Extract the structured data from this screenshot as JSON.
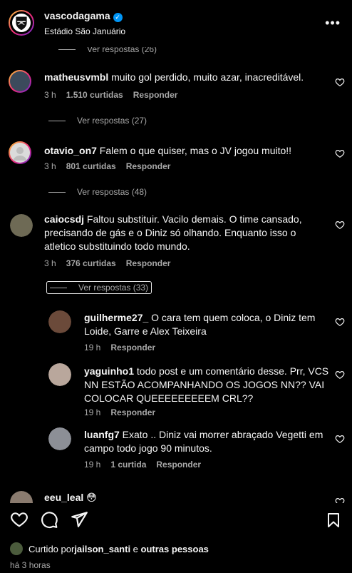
{
  "header": {
    "username": "vascodagama",
    "location": "Estádio São Januário"
  },
  "top_replies_partial": "Ver respostas (26)",
  "comments": [
    {
      "username": "matheusvmbl",
      "text": "muito gol perdido, muito azar, inacreditável.",
      "time": "3 h",
      "likes": "1.510 curtidas",
      "reply": "Responder",
      "replies": "Ver respostas (27)"
    },
    {
      "username": "otavio_on7",
      "text": "Falem o que quiser, mas o JV jogou muito!!",
      "time": "3 h",
      "likes": "801 curtidas",
      "reply": "Responder",
      "replies": "Ver respostas (48)"
    },
    {
      "username": "caiocsdj",
      "text": "Faltou substituir. Vacilo demais. O time cansado, precisando de gás e o Diniz só olhando. Enquanto isso o atletico substituindo todo mundo.",
      "time": "3 h",
      "likes": "376 curtidas",
      "reply": "Responder",
      "replies": "Ver respostas (33)"
    }
  ],
  "replies": [
    {
      "username": "guilherme27_",
      "text": "O cara tem quem coloca, o Diniz tem Loide, Garre e Alex Teixeira",
      "time": "19 h",
      "reply": "Responder"
    },
    {
      "username": "yaguinho1",
      "text": "todo post e um comentário desse. Prr, VCS NN ESTÃO ACOMPANHANDO OS JOGOS NN?? VAI COLOCAR QUEEEEEEEEEM CRL??",
      "time": "19 h",
      "reply": "Responder"
    },
    {
      "username": "luanfg7",
      "text": "Exato .. Diniz vai morrer abraçado Vegetti em campo todo jogo 90 minutos.",
      "time": "19 h",
      "likes": "1 curtida",
      "reply": "Responder"
    }
  ],
  "partial_comment": {
    "username": "eeu_leal",
    "emoji": "😳"
  },
  "footer": {
    "liked_prefix": "Curtido por ",
    "liked_user": "jailson_santi",
    "liked_suffix": " e ",
    "liked_others": "outras pessoas",
    "time": "há 3 horas"
  }
}
